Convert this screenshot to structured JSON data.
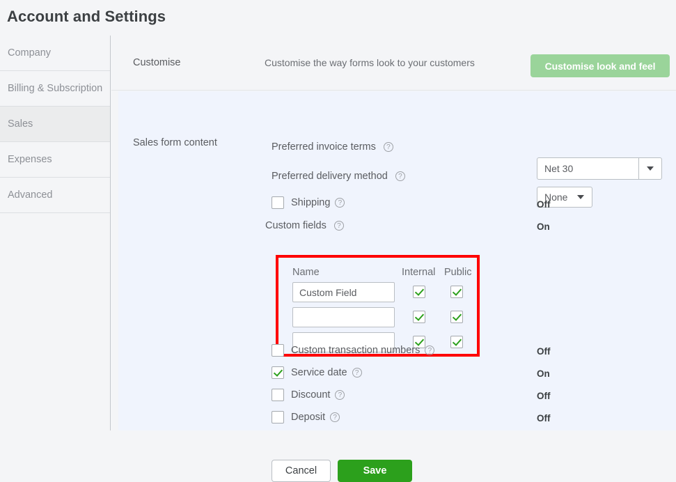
{
  "page": {
    "title": "Account and Settings"
  },
  "sidebar": {
    "items": [
      {
        "label": "Company",
        "active": false
      },
      {
        "label": "Billing & Subscription",
        "active": false
      },
      {
        "label": "Sales",
        "active": true
      },
      {
        "label": "Expenses",
        "active": false
      },
      {
        "label": "Advanced",
        "active": false
      }
    ]
  },
  "customise_section": {
    "heading": "Customise",
    "description": "Customise the way forms look to your customers",
    "button_label": "Customise look and feel",
    "button_color": "#9ad49a"
  },
  "sales_form_content": {
    "heading": "Sales form content",
    "preferred_invoice_terms": {
      "label": "Preferred invoice terms",
      "help_icon": "question-icon",
      "value": "Net 30"
    },
    "preferred_delivery_method": {
      "label": "Preferred delivery method",
      "help_icon": "question-icon",
      "value": "None"
    },
    "shipping": {
      "label": "Shipping",
      "help_icon": "question-icon",
      "checked": false,
      "state": "Off"
    },
    "custom_fields": {
      "label": "Custom fields",
      "help_icon": "question-icon",
      "state": "On",
      "highlight_color": "#fe0000",
      "columns": [
        "Name",
        "Internal",
        "Public"
      ],
      "rows": [
        {
          "name": "Custom Field",
          "internal": true,
          "public": true
        },
        {
          "name": "",
          "internal": true,
          "public": true
        },
        {
          "name": "",
          "internal": true,
          "public": true
        }
      ]
    },
    "toggles": [
      {
        "label": "Custom transaction numbers",
        "help_icon": "question-icon",
        "checked": false,
        "state": "Off"
      },
      {
        "label": "Service date",
        "help_icon": "question-icon",
        "checked": true,
        "state": "On"
      },
      {
        "label": "Discount",
        "help_icon": "question-icon",
        "checked": false,
        "state": "Off"
      },
      {
        "label": "Deposit",
        "help_icon": "question-icon",
        "checked": false,
        "state": "Off"
      }
    ],
    "footer": {
      "cancel_label": "Cancel",
      "save_label": "Save",
      "save_color": "#2ca01c"
    }
  }
}
